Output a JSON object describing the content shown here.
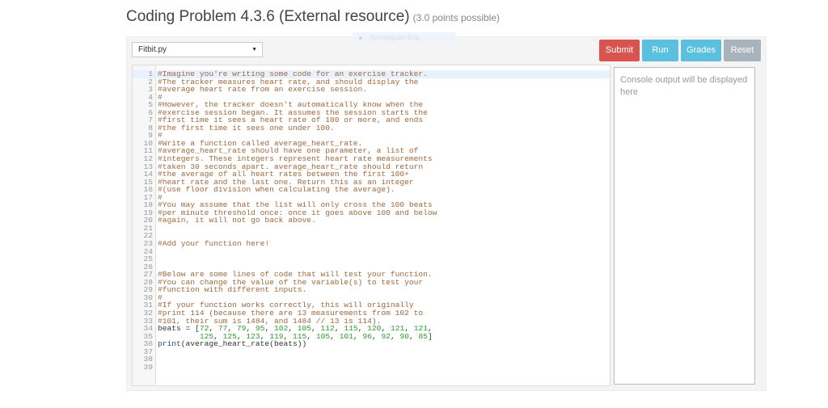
{
  "page": {
    "title": "Coding Problem 4.3.6 (External resource)",
    "points": "(3.0 points possible)"
  },
  "overlay": {
    "snip_label": "Rectangular Snip"
  },
  "toolbar": {
    "file_select": "Fitbit.py",
    "submit": "Submit",
    "run": "Run",
    "grades": "Grades",
    "reset": "Reset"
  },
  "colors": {
    "submit": "#d9534f",
    "run": "#5bc0de",
    "grades": "#5bc0de",
    "reset": "#a9b3bc"
  },
  "console": {
    "placeholder": "Console output will be displayed here"
  },
  "editor": {
    "lines": [
      "#Imagine you're writing some code for an exercise tracker.",
      "#The tracker measures heart rate, and should display the",
      "#average heart rate from an exercise session.",
      "#",
      "#However, the tracker doesn't automatically know when the",
      "#exercise session began. It assumes the session starts the",
      "#first time it sees a heart rate of 100 or more, and ends",
      "#the first time it sees one under 100.",
      "#",
      "#Write a function called average_heart_rate.",
      "#average_heart_rate should have one parameter, a list of",
      "#integers. These integers represent heart rate measurements",
      "#taken 30 seconds apart. average_heart_rate should return",
      "#the average of all heart rates between the first 100+",
      "#heart rate and the last one. Return this as an integer",
      "#(use floor division when calculating the average).",
      "#",
      "#You may assume that the list will only cross the 100 beats",
      "#per minute threshold once: once it goes above 100 and below",
      "#again, it will not go back above.",
      "",
      "",
      "#Add your function here!",
      "",
      "",
      "",
      "#Below are some lines of code that will test your function.",
      "#You can change the value of the variable(s) to test your",
      "#function with different inputs.",
      "#",
      "#If your function works correctly, this will originally",
      "#print 114 (because there are 13 measurements from 102 to",
      "#101, their sum is 1484, and 1484 // 13 is 114).",
      "beats = [72, 77, 79, 95, 102, 105, 112, 115, 120, 121, 121,",
      "         125, 125, 123, 119, 115, 105, 101, 96, 92, 90, 85]",
      "print(average_heart_rate(beats))",
      "",
      "",
      ""
    ]
  }
}
